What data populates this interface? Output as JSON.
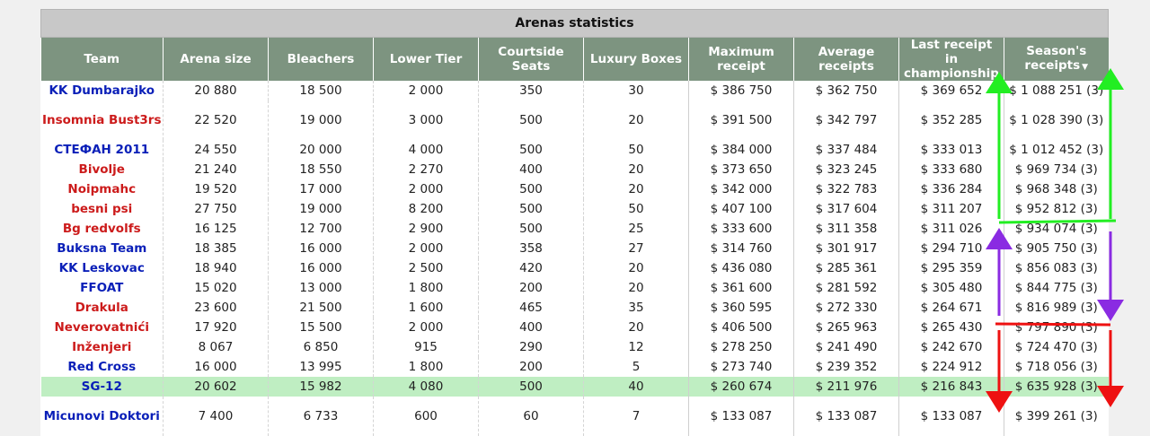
{
  "title": "Arenas statistics",
  "headers": {
    "team": "Team",
    "arena_size": "Arena size",
    "bleachers": "Bleachers",
    "lower_tier": "Lower Tier",
    "courtside": "Courtside Seats",
    "luxury": "Luxury Boxes",
    "max_receipt_l1": "Maximum",
    "max_receipt_l2": "receipt",
    "avg_receipts_l1": "Average",
    "avg_receipts_l2": "receipts",
    "last_receipt_l1": "Last receipt in",
    "last_receipt_l2": "championship",
    "season_receipts_l1": "Season's",
    "season_receipts_l2": "receipts",
    "sort_indicator": "▼"
  },
  "colors": {
    "title_bg": "#c8c8c8",
    "header_bg": "#7d9480",
    "team_blue": "#0a1fb8",
    "team_red": "#cc1b1b",
    "highlight_row": "#bfeec2",
    "arrow_green": "#22ee22",
    "arrow_purple": "#8a2be2",
    "arrow_red": "#ee1111"
  },
  "rows": [
    {
      "team": "KK Dumbarajko",
      "team_color": "blue",
      "arena_size": "20 880",
      "bleachers": "18 500",
      "lower_tier": "2 000",
      "courtside": "350",
      "luxury": "30",
      "max_receipt": "$ 386 750",
      "avg_receipts": "$ 362 750",
      "last_receipt": "$ 369 652",
      "season_receipts": "$ 1 088 251 (3)"
    },
    {
      "team": "Insomnia Bust3rs",
      "team_color": "red",
      "arena_size": "22 520",
      "bleachers": "19 000",
      "lower_tier": "3 000",
      "courtside": "500",
      "luxury": "20",
      "max_receipt": "$ 391 500",
      "avg_receipts": "$ 342 797",
      "last_receipt": "$ 352 285",
      "season_receipts": "$ 1 028 390 (3)"
    },
    {
      "team": "СТЕФАН 2011",
      "team_color": "blue",
      "arena_size": "24 550",
      "bleachers": "20 000",
      "lower_tier": "4 000",
      "courtside": "500",
      "luxury": "50",
      "max_receipt": "$ 384 000",
      "avg_receipts": "$ 337 484",
      "last_receipt": "$ 333 013",
      "season_receipts": "$ 1 012 452 (3)"
    },
    {
      "team": "Bivolje",
      "team_color": "red",
      "arena_size": "21 240",
      "bleachers": "18 550",
      "lower_tier": "2 270",
      "courtside": "400",
      "luxury": "20",
      "max_receipt": "$ 373 650",
      "avg_receipts": "$ 323 245",
      "last_receipt": "$ 333 680",
      "season_receipts": "$ 969 734 (3)"
    },
    {
      "team": "Noipmahc",
      "team_color": "red",
      "arena_size": "19 520",
      "bleachers": "17 000",
      "lower_tier": "2 000",
      "courtside": "500",
      "luxury": "20",
      "max_receipt": "$ 342 000",
      "avg_receipts": "$ 322 783",
      "last_receipt": "$ 336 284",
      "season_receipts": "$ 968 348 (3)"
    },
    {
      "team": "besni psi",
      "team_color": "red",
      "arena_size": "27 750",
      "bleachers": "19 000",
      "lower_tier": "8 200",
      "courtside": "500",
      "luxury": "50",
      "max_receipt": "$ 407 100",
      "avg_receipts": "$ 317 604",
      "last_receipt": "$ 311 207",
      "season_receipts": "$ 952 812 (3)"
    },
    {
      "team": "Bg redvolfs",
      "team_color": "red",
      "arena_size": "16 125",
      "bleachers": "12 700",
      "lower_tier": "2 900",
      "courtside": "500",
      "luxury": "25",
      "max_receipt": "$ 333 600",
      "avg_receipts": "$ 311 358",
      "last_receipt": "$ 311 026",
      "season_receipts": "$ 934 074 (3)"
    },
    {
      "team": "Buksna Team",
      "team_color": "blue",
      "arena_size": "18 385",
      "bleachers": "16 000",
      "lower_tier": "2 000",
      "courtside": "358",
      "luxury": "27",
      "max_receipt": "$ 314 760",
      "avg_receipts": "$ 301 917",
      "last_receipt": "$ 294 710",
      "season_receipts": "$ 905 750 (3)"
    },
    {
      "team": "KK Leskovac",
      "team_color": "blue",
      "arena_size": "18 940",
      "bleachers": "16 000",
      "lower_tier": "2 500",
      "courtside": "420",
      "luxury": "20",
      "max_receipt": "$ 436 080",
      "avg_receipts": "$ 285 361",
      "last_receipt": "$ 295 359",
      "season_receipts": "$ 856 083 (3)"
    },
    {
      "team": "FFOAT",
      "team_color": "blue",
      "arena_size": "15 020",
      "bleachers": "13 000",
      "lower_tier": "1 800",
      "courtside": "200",
      "luxury": "20",
      "max_receipt": "$ 361 600",
      "avg_receipts": "$ 281 592",
      "last_receipt": "$ 305 480",
      "season_receipts": "$ 844 775 (3)"
    },
    {
      "team": "Drakula",
      "team_color": "red",
      "arena_size": "23 600",
      "bleachers": "21 500",
      "lower_tier": "1 600",
      "courtside": "465",
      "luxury": "35",
      "max_receipt": "$ 360 595",
      "avg_receipts": "$ 272 330",
      "last_receipt": "$ 264 671",
      "season_receipts": "$ 816 989 (3)"
    },
    {
      "team": "Neverovatnići",
      "team_color": "red",
      "arena_size": "17 920",
      "bleachers": "15 500",
      "lower_tier": "2 000",
      "courtside": "400",
      "luxury": "20",
      "max_receipt": "$ 406 500",
      "avg_receipts": "$ 265 963",
      "last_receipt": "$ 265 430",
      "season_receipts": "$ 797 890 (3)"
    },
    {
      "team": "Inženjeri",
      "team_color": "red",
      "arena_size": "8 067",
      "bleachers": "6 850",
      "lower_tier": "915",
      "courtside": "290",
      "luxury": "12",
      "max_receipt": "$ 278 250",
      "avg_receipts": "$ 241 490",
      "last_receipt": "$ 242 670",
      "season_receipts": "$ 724 470 (3)"
    },
    {
      "team": "Red Cross",
      "team_color": "blue",
      "arena_size": "16 000",
      "bleachers": "13 995",
      "lower_tier": "1 800",
      "courtside": "200",
      "luxury": "5",
      "max_receipt": "$ 273 740",
      "avg_receipts": "$ 239 352",
      "last_receipt": "$ 224 912",
      "season_receipts": "$ 718 056 (3)"
    },
    {
      "team": "SG-12",
      "team_color": "blue",
      "highlight": true,
      "arena_size": "20 602",
      "bleachers": "15 982",
      "lower_tier": "4 080",
      "courtside": "500",
      "luxury": "40",
      "max_receipt": "$ 260 674",
      "avg_receipts": "$ 211 976",
      "last_receipt": "$ 216 843",
      "season_receipts": "$ 635 928 (3)"
    },
    {
      "team": "Micunovi Doktori",
      "team_color": "blue",
      "arena_size": "7 400",
      "bleachers": "6 733",
      "lower_tier": "600",
      "courtside": "60",
      "luxury": "7",
      "max_receipt": "$ 133 087",
      "avg_receipts": "$ 133 087",
      "last_receipt": "$ 133 087",
      "season_receipts": "$ 399 261 (3)"
    }
  ]
}
